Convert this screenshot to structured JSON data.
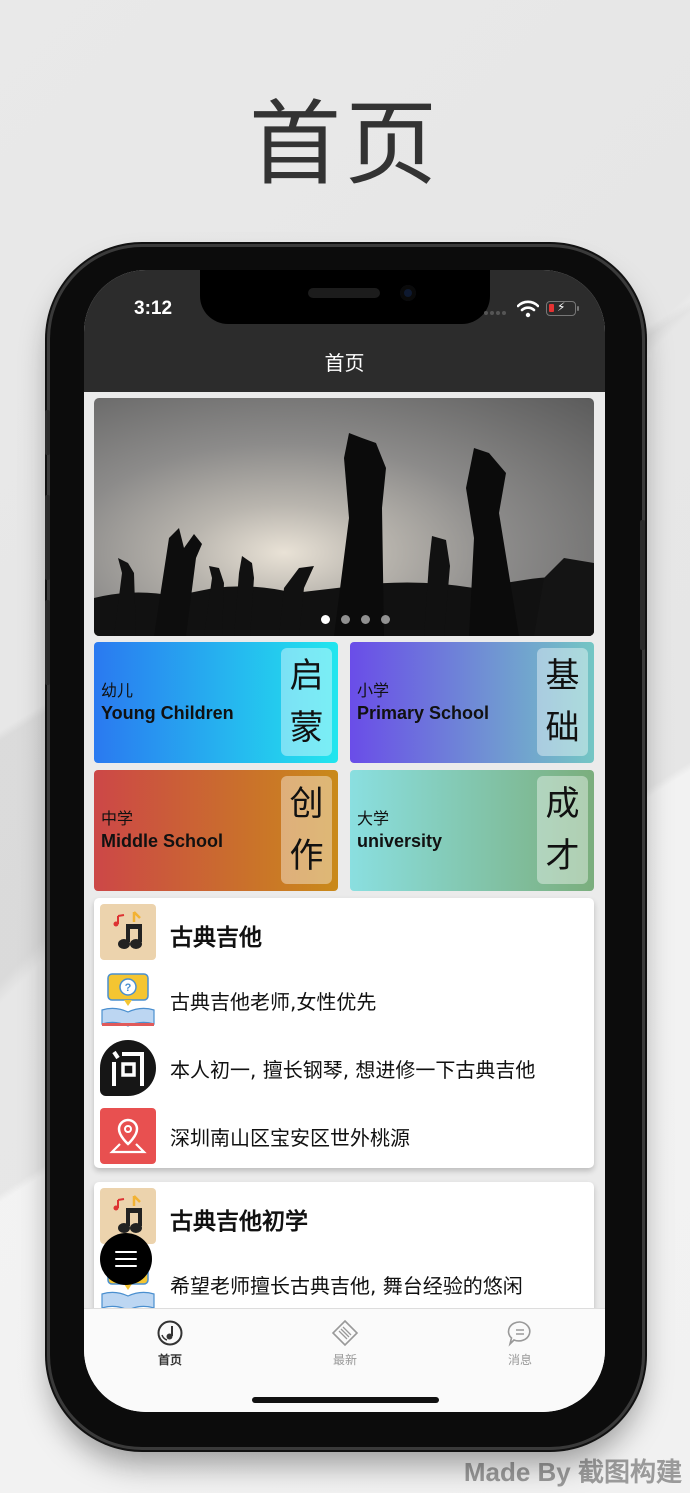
{
  "page_heading": "首页",
  "watermark": "Made By 截图构建",
  "status_bar": {
    "time": "3:12",
    "battery_state": "low-charging"
  },
  "nav_title": "首页",
  "banner": {
    "dots": 4,
    "active_index": 0,
    "image_desc": "concert crowd hands silhouette"
  },
  "categories": [
    {
      "zh": "幼儿",
      "en": "Young Children",
      "badge": "启蒙",
      "gradient_from": "#2a79f0",
      "gradient_to": "#22e6ee"
    },
    {
      "zh": "小学",
      "en": "Primary School",
      "badge": "基础",
      "gradient_from": "#6a4de8",
      "gradient_to": "#74c6c4"
    },
    {
      "zh": "中学",
      "en": "Middle School",
      "badge": "创作",
      "gradient_from": "#cc4747",
      "gradient_to": "#c98a1a"
    },
    {
      "zh": "大学",
      "en": "university",
      "badge": "成才",
      "gradient_from": "#8adfe0",
      "gradient_to": "#7bae7d"
    }
  ],
  "posts": [
    {
      "title": "古典吉他",
      "requirement": "古典吉他老师,女性优先",
      "question": "本人初一, 擅长钢琴, 想进修一下古典吉他",
      "location": "深圳南山区宝安区世外桃源"
    },
    {
      "title": "古典吉他初学",
      "requirement": "希望老师擅长古典吉他, 舞台经验的悠闲"
    }
  ],
  "icons": {
    "music": "music-notes-icon",
    "question_book": "question-book-icon",
    "ask": "ask-icon",
    "location": "map-pin-icon"
  },
  "tabbar": {
    "items": [
      {
        "label": "首页",
        "icon": "disc-icon",
        "active": true
      },
      {
        "label": "最新",
        "icon": "news-icon",
        "active": false
      },
      {
        "label": "消息",
        "icon": "chat-icon",
        "active": false
      }
    ]
  }
}
